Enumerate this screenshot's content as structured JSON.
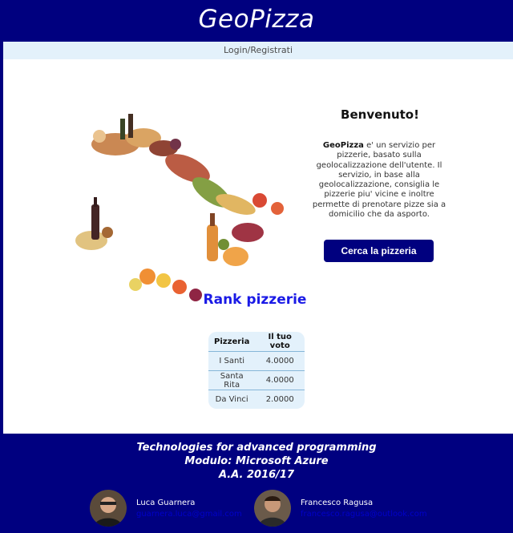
{
  "header": {
    "title": "GeoPizza"
  },
  "nav": {
    "login_label": "Login/Registrati"
  },
  "welcome": {
    "title": "Benvenuto!",
    "brand": "GeoPizza",
    "text": " e' un servizio per pizzerie, basato sulla geolocalizzazione dell'utente. Il servizio, in base alla geolocalizzazione, consiglia le pizzerie piu' vicine e inoltre permette di prenotare pizze sia a domicilio che da asporto.",
    "button_label": "Cerca la pizzeria"
  },
  "rank": {
    "title": "Rank pizzerie",
    "columns": [
      "Pizzeria",
      "Il tuo voto"
    ],
    "rows": [
      {
        "name": "I Santi",
        "vote": "4.0000"
      },
      {
        "name": "Santa Rita",
        "vote": "4.0000"
      },
      {
        "name": "Da Vinci",
        "vote": "2.0000"
      }
    ]
  },
  "footer": {
    "line1": "Technologies for advanced programming",
    "line2": "Modulo: Microsoft Azure",
    "line3": "A.A. 2016/17",
    "authors": [
      {
        "name": "Luca Guarnera",
        "email": "guarnera.luca@gmail.com"
      },
      {
        "name": "Francesco Ragusa",
        "email": "francesco.ragusa@outlook.com"
      }
    ]
  },
  "colors": {
    "header_bg": "#00007f",
    "nav_bg": "#e3f1fb",
    "rank_title": "#1a1ae6",
    "button_bg": "#00007f"
  }
}
